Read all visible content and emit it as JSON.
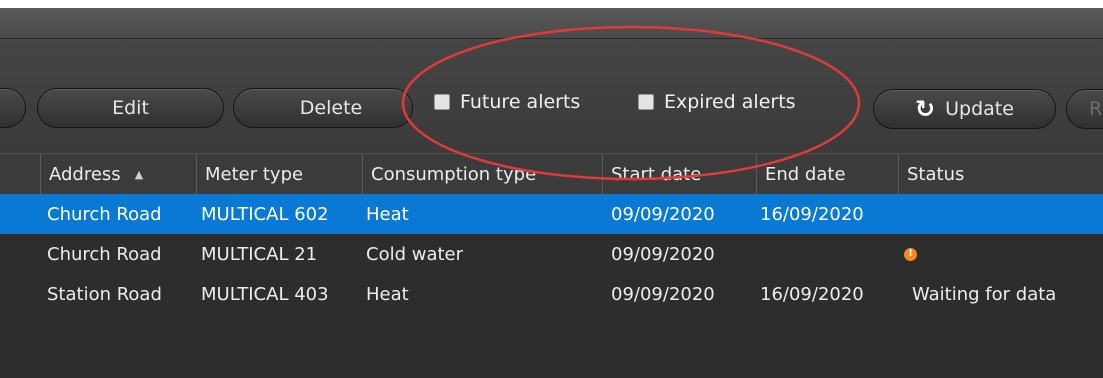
{
  "toolbar": {
    "edit_label": "Edit",
    "delete_label": "Delete",
    "future_alerts_label": "Future alerts",
    "expired_alerts_label": "Expired alerts",
    "update_label": "Update",
    "update_icon": "refresh-icon",
    "next_button_partial": "R"
  },
  "grid": {
    "columns": [
      "Address",
      "Meter type",
      "Consumption type",
      "Start date",
      "End date",
      "Status"
    ],
    "sort": {
      "column": "Address",
      "direction": "ascending"
    },
    "rows": [
      {
        "address": "Church Road",
        "meter_type": "MULTICAL 602",
        "consumption_type": "Heat",
        "start_date": "09/09/2020",
        "end_date": "16/09/2020",
        "status": "",
        "selected": true
      },
      {
        "address": "Church Road",
        "meter_type": "MULTICAL 21",
        "consumption_type": "Cold water",
        "start_date": "09/09/2020",
        "end_date": "",
        "status": "",
        "status_icon": "warning-icon",
        "selected": false
      },
      {
        "address": "Station Road",
        "meter_type": "MULTICAL 403",
        "consumption_type": "Heat",
        "start_date": "09/09/2020",
        "end_date": "16/09/2020",
        "status": "Waiting for data",
        "selected": false
      }
    ]
  },
  "colors": {
    "background": "#2d2d2d",
    "selection": "#0a79d3",
    "highlight_ring": "#e03a3a",
    "warning": "#f08a1c"
  }
}
